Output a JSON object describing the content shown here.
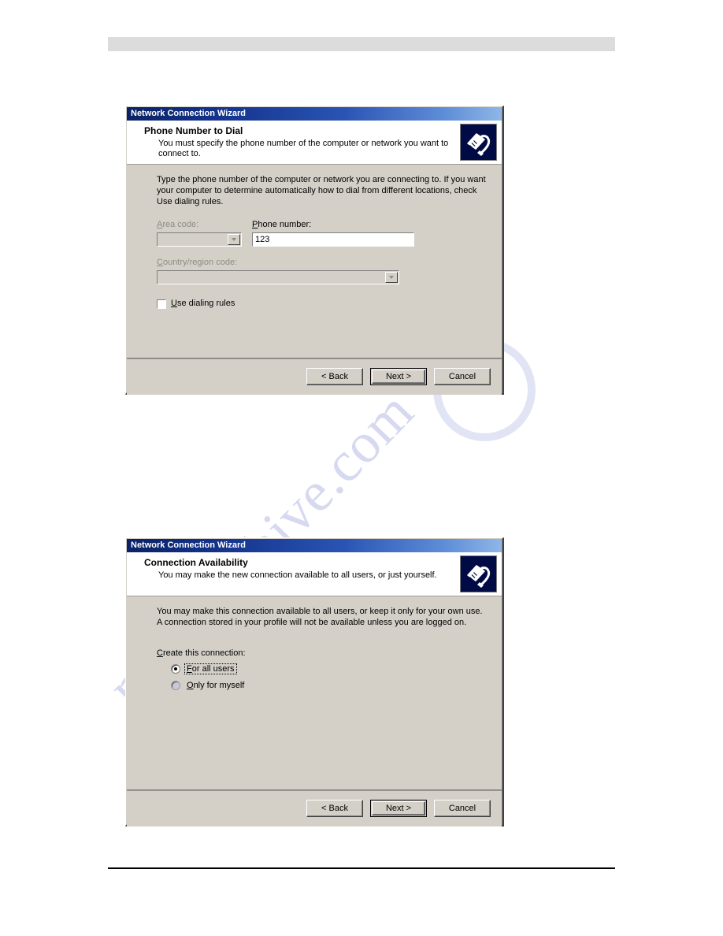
{
  "page": {
    "header_band": "",
    "watermark": "manualshive.com"
  },
  "dialogs": [
    {
      "titlebar": "Network Connection Wizard",
      "heading": "Phone Number to Dial",
      "subheading": "You must specify the phone number of the computer or network you want to connect to.",
      "icon": "network-jack-icon",
      "body_text": "Type the phone number of the computer or network you are connecting to. If you want your computer to determine automatically how to dial from different locations, check Use dialing rules.",
      "fields": {
        "area_code_label": "Area code:",
        "area_code_value": "",
        "area_code_enabled": false,
        "phone_number_label": "Phone number:",
        "phone_number_value": "123",
        "phone_number_placeholder": "",
        "country_label": "Country/region code:",
        "country_value": "",
        "country_enabled": false,
        "dialing_rules_label": "Use dialing rules",
        "dialing_rules_checked": false
      },
      "buttons": {
        "back": "< Back",
        "next": "Next >",
        "cancel": "Cancel",
        "default": "next"
      }
    },
    {
      "titlebar": "Network Connection Wizard",
      "heading": "Connection Availability",
      "subheading": "You may make the new connection available to all users, or just yourself.",
      "icon": "network-jack-icon",
      "body_text": "You may make this connection available to all users, or keep it only for your own use.  A connection stored in your profile will not be available unless you are logged on.",
      "radio_group": {
        "caption": "Create this connection:",
        "options": [
          {
            "label": "For all users",
            "selected": true,
            "focused": true
          },
          {
            "label": "Only for myself",
            "selected": false,
            "focused": false
          }
        ]
      },
      "buttons": {
        "back": "< Back",
        "next": "Next >",
        "cancel": "Cancel",
        "default": "next"
      }
    }
  ],
  "colors": {
    "dialog_face": "#d4d0c8",
    "titlebar_start": "#0a2265",
    "titlebar_end": "#8fb6e8",
    "icon_background": "#000b46",
    "header_band": "#dcdcdc",
    "watermark": "#7882cd"
  }
}
